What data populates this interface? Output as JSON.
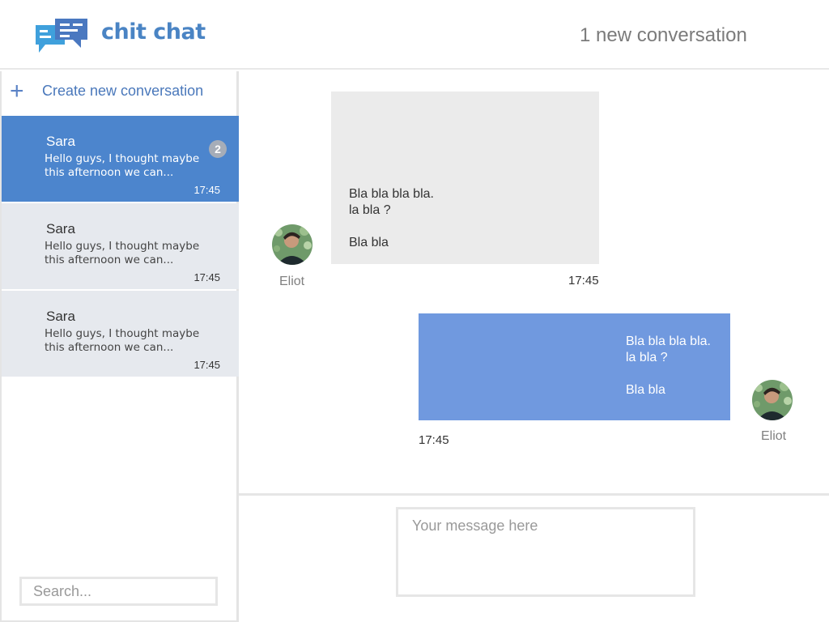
{
  "header": {
    "brand": "chit chat",
    "notification": "1 new conversation"
  },
  "sidebar": {
    "create_label": "Create new conversation",
    "conversations": [
      {
        "name": "Sara",
        "preview": "Hello guys, I thought maybe this afternoon we can...",
        "time": "17:45",
        "unread": "2",
        "active": true
      },
      {
        "name": "Sara",
        "preview": "Hello guys, I thought maybe this afternoon we can...",
        "time": "17:45",
        "unread": "",
        "active": false
      },
      {
        "name": "Sara",
        "preview": "Hello guys, I thought maybe this afternoon we can...",
        "time": "17:45",
        "unread": "",
        "active": false
      }
    ],
    "search_placeholder": "Search..."
  },
  "messages": [
    {
      "author": "Eliot",
      "text": "Bla bla bla bla.\nla bla ?\n\nBla bla",
      "time": "17:45",
      "direction": "incoming"
    },
    {
      "author": "Eliot",
      "text": "Bla bla bla bla.\nla bla ?\n\nBla bla",
      "time": "17:45",
      "direction": "outgoing"
    }
  ],
  "composer": {
    "placeholder": "Your message here"
  },
  "colors": {
    "brand": "#4a84c4",
    "active_conversation": "#4c85cd",
    "outgoing_bubble": "#7099df",
    "incoming_bubble": "#ebebeb"
  }
}
